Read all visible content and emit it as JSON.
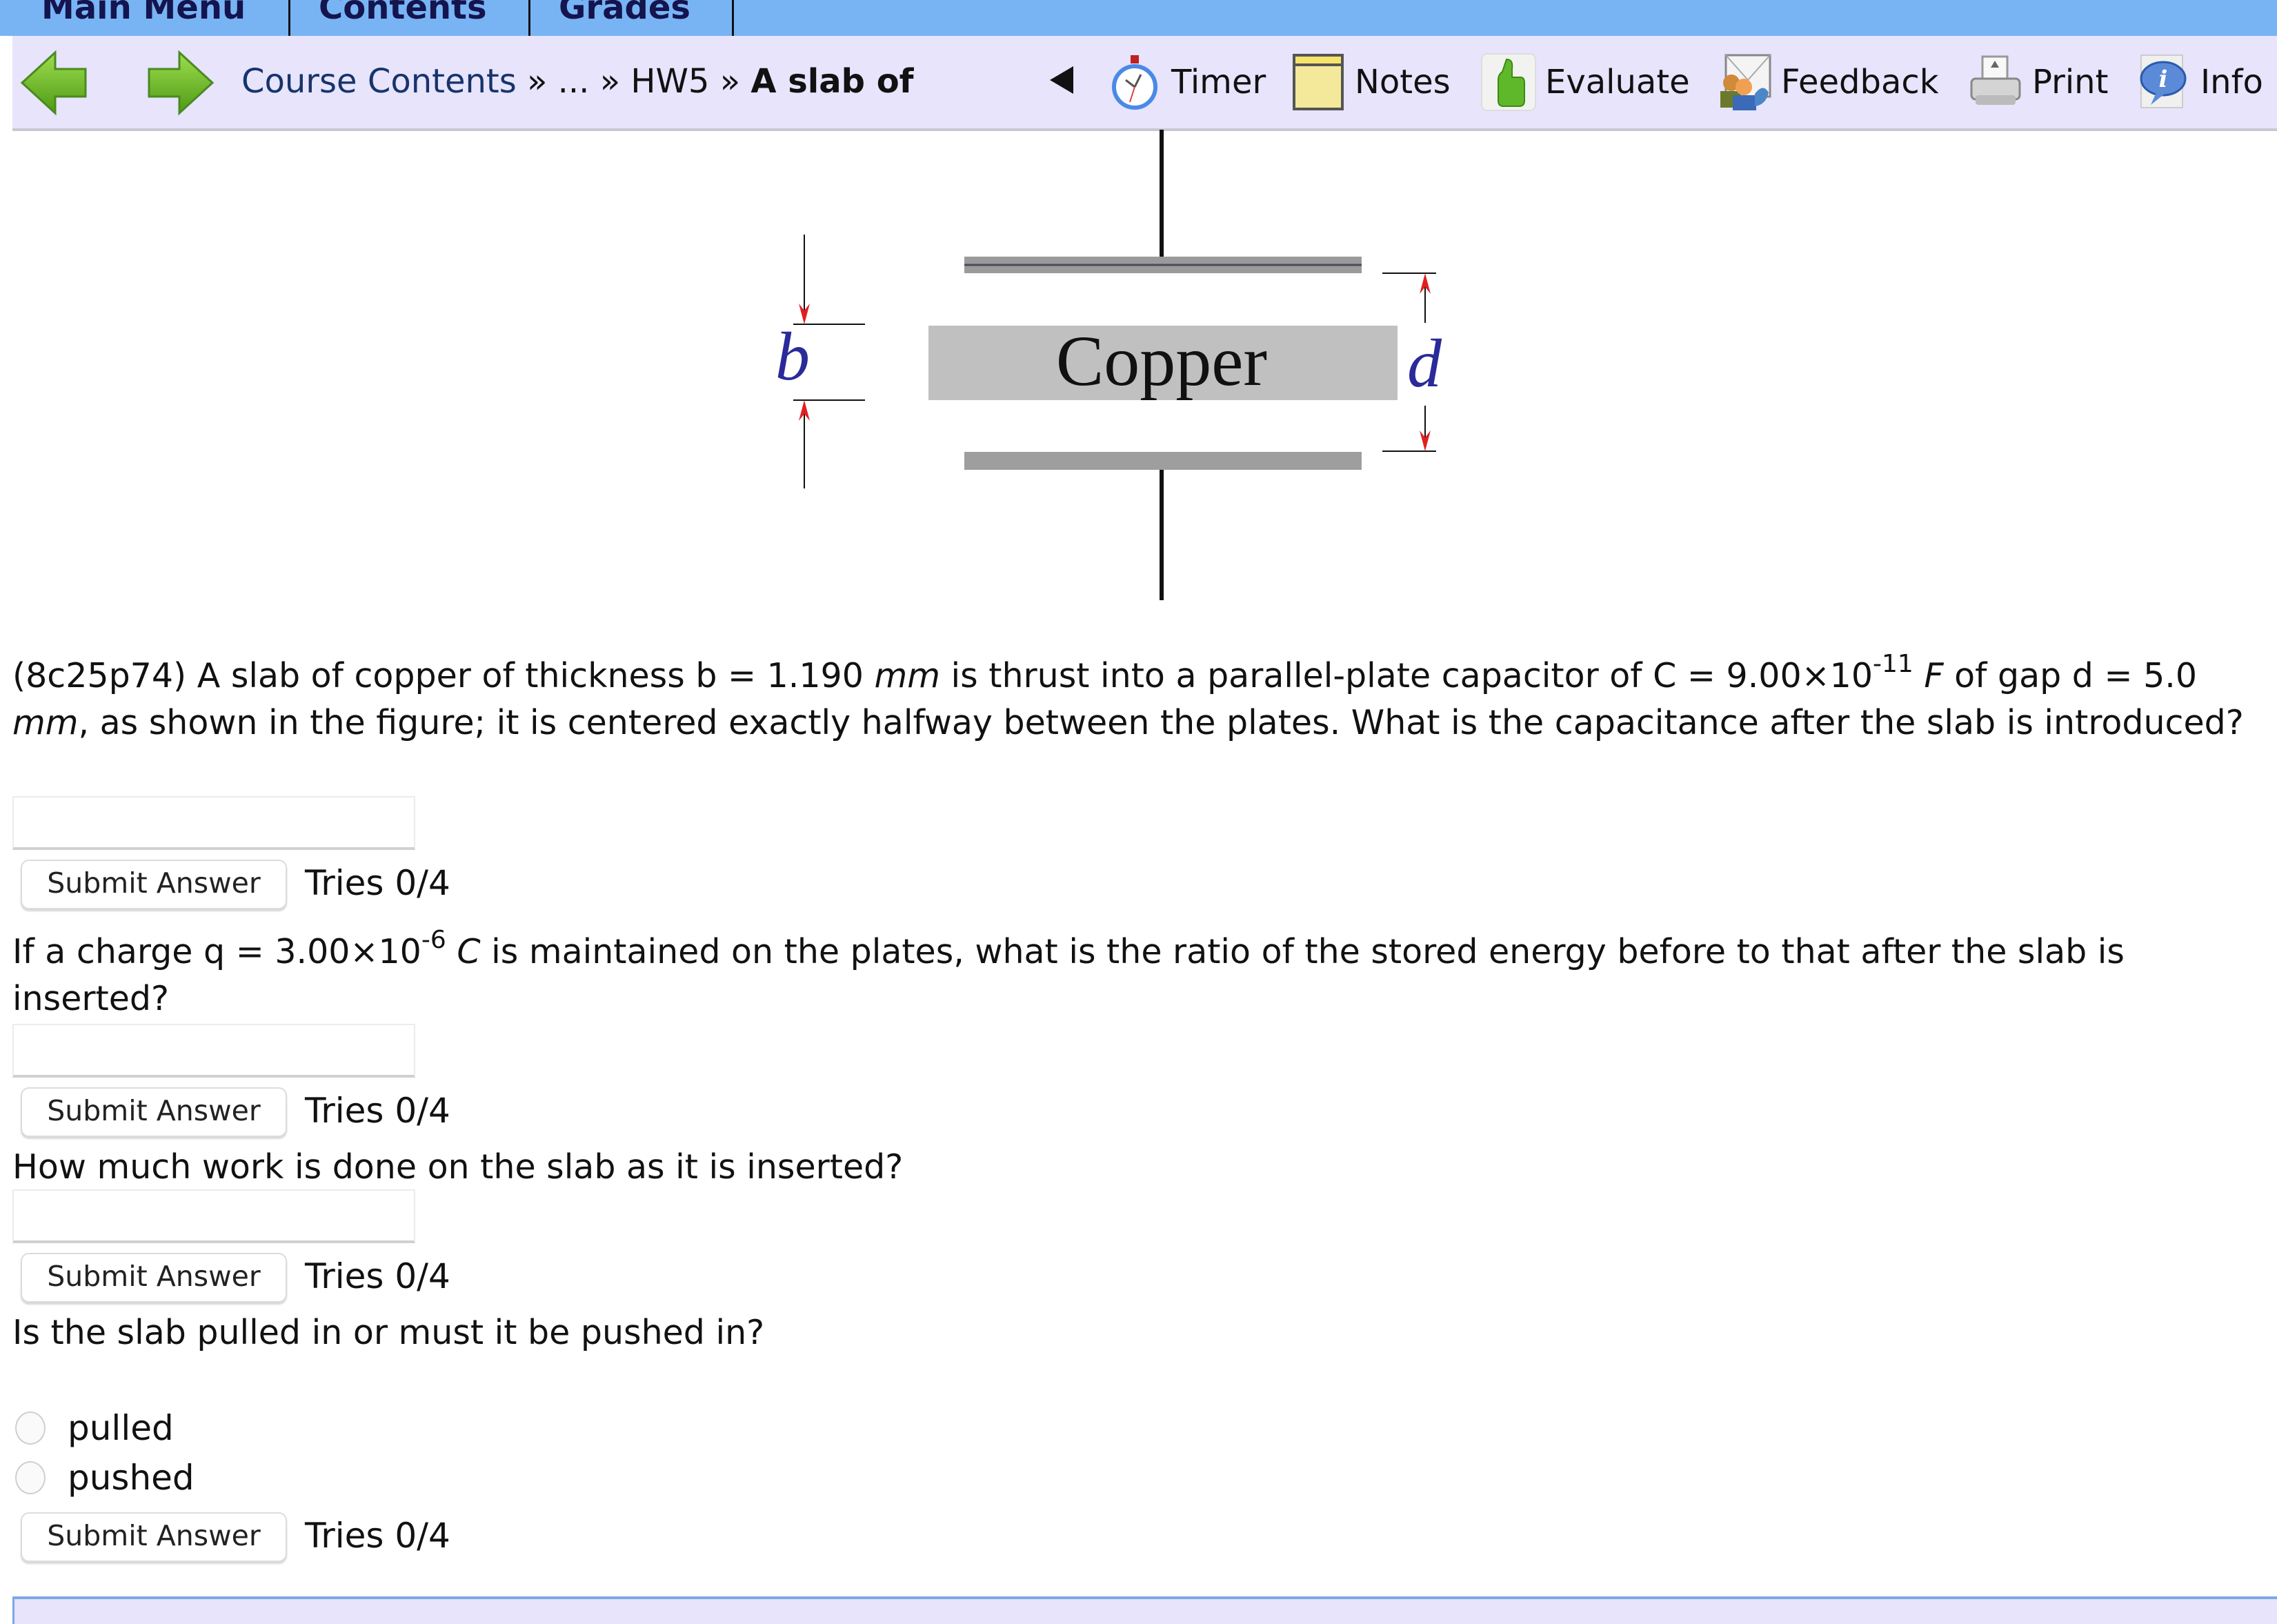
{
  "tabs": [
    {
      "label": "Main Menu"
    },
    {
      "label": "Contents"
    },
    {
      "label": "Grades"
    }
  ],
  "nav": {
    "back_icon": "green-left-arrow-icon",
    "forward_icon": "green-right-arrow-icon",
    "breadcrumb": {
      "items": [
        "Course Contents",
        "...",
        "HW5"
      ],
      "separator": "»",
      "current": "A slab of"
    },
    "collapse_icon": "triangle-left-icon",
    "tools": [
      {
        "label": "Timer",
        "icon": "stopwatch-icon"
      },
      {
        "label": "Notes",
        "icon": "notepad-icon"
      },
      {
        "label": "Evaluate",
        "icon": "thumbs-up-icon"
      },
      {
        "label": "Feedback",
        "icon": "feedback-envelope-icon"
      },
      {
        "label": "Print",
        "icon": "printer-icon"
      },
      {
        "label": "Info",
        "icon": "info-bubble-icon"
      }
    ]
  },
  "figure": {
    "slab_label": "Copper",
    "thickness_label": "b",
    "gap_label": "d",
    "colors": {
      "arrow": "#e02020",
      "label": "#2a2a9a",
      "slab": "#c0c0c0",
      "plate": "#999999"
    }
  },
  "problem": {
    "q1": {
      "id": "(8c25p74)",
      "t1": " A slab of copper of thickness b = 1.190 ",
      "u1": "mm",
      "t2": " is thrust into a parallel-plate capacitor of C = 9.00×10",
      "exp1": "-11",
      "u2": "F",
      "t3": " of gap d = 5.0 ",
      "u3": "mm",
      "t4": ", as shown in the figure; it is centered exactly halfway between the plates. What is the capacitance after the slab is introduced?",
      "input_value": "",
      "submit_label": "Submit Answer",
      "tries": "Tries 0/4"
    },
    "q2": {
      "t1": "If a charge q = 3.00×10",
      "exp1": "-6",
      "u1": "C",
      "t2": " is maintained on the plates, what is the ratio of the stored energy before to that after the slab is inserted?",
      "input_value": "",
      "submit_label": "Submit Answer",
      "tries": "Tries 0/4"
    },
    "q3": {
      "text": "How much work is done on the slab as it is inserted?",
      "input_value": "",
      "submit_label": "Submit Answer",
      "tries": "Tries 0/4"
    },
    "q4": {
      "text": "Is the slab pulled in or must it be pushed in?",
      "options": [
        "pulled",
        "pushed"
      ],
      "selected": null,
      "submit_label": "Submit Answer",
      "tries": "Tries 0/4"
    }
  }
}
